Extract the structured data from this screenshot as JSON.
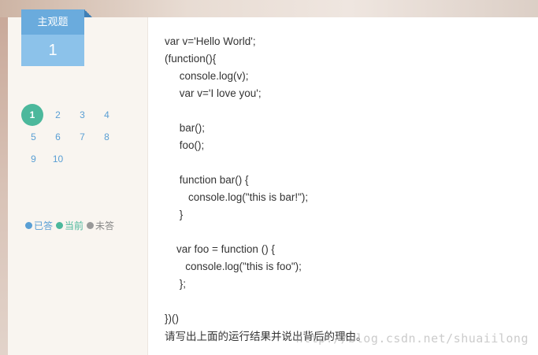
{
  "question_type": {
    "label": "主观题",
    "number": "1"
  },
  "question_nav": {
    "items": [
      "1",
      "2",
      "3",
      "4",
      "5",
      "6",
      "7",
      "8",
      "9",
      "10"
    ],
    "current": "1"
  },
  "legend": {
    "answered": "已答",
    "current": "当前",
    "unanswered": "未答"
  },
  "code_lines": [
    "var v='Hello World';",
    "(function(){",
    "     console.log(v);",
    "     var v='I love you';",
    "",
    "     bar();",
    "     foo();",
    "",
    "     function bar() {",
    "        console.log(\"this is bar!\");",
    "     }",
    "",
    "    var foo = function () {",
    "       console.log(\"this is foo\");",
    "     };",
    "",
    "})()"
  ],
  "question_text": "请写出上面的运行结果并说出背后的理由。",
  "watermark": "http://blog.csdn.net/shuaiilong",
  "colors": {
    "type_title_bg": "#6aabdd",
    "type_num_bg": "#8cc2ea",
    "current_green": "#4cb89c",
    "answered_blue": "#5a9fd4",
    "unanswered_gray": "#999999"
  }
}
